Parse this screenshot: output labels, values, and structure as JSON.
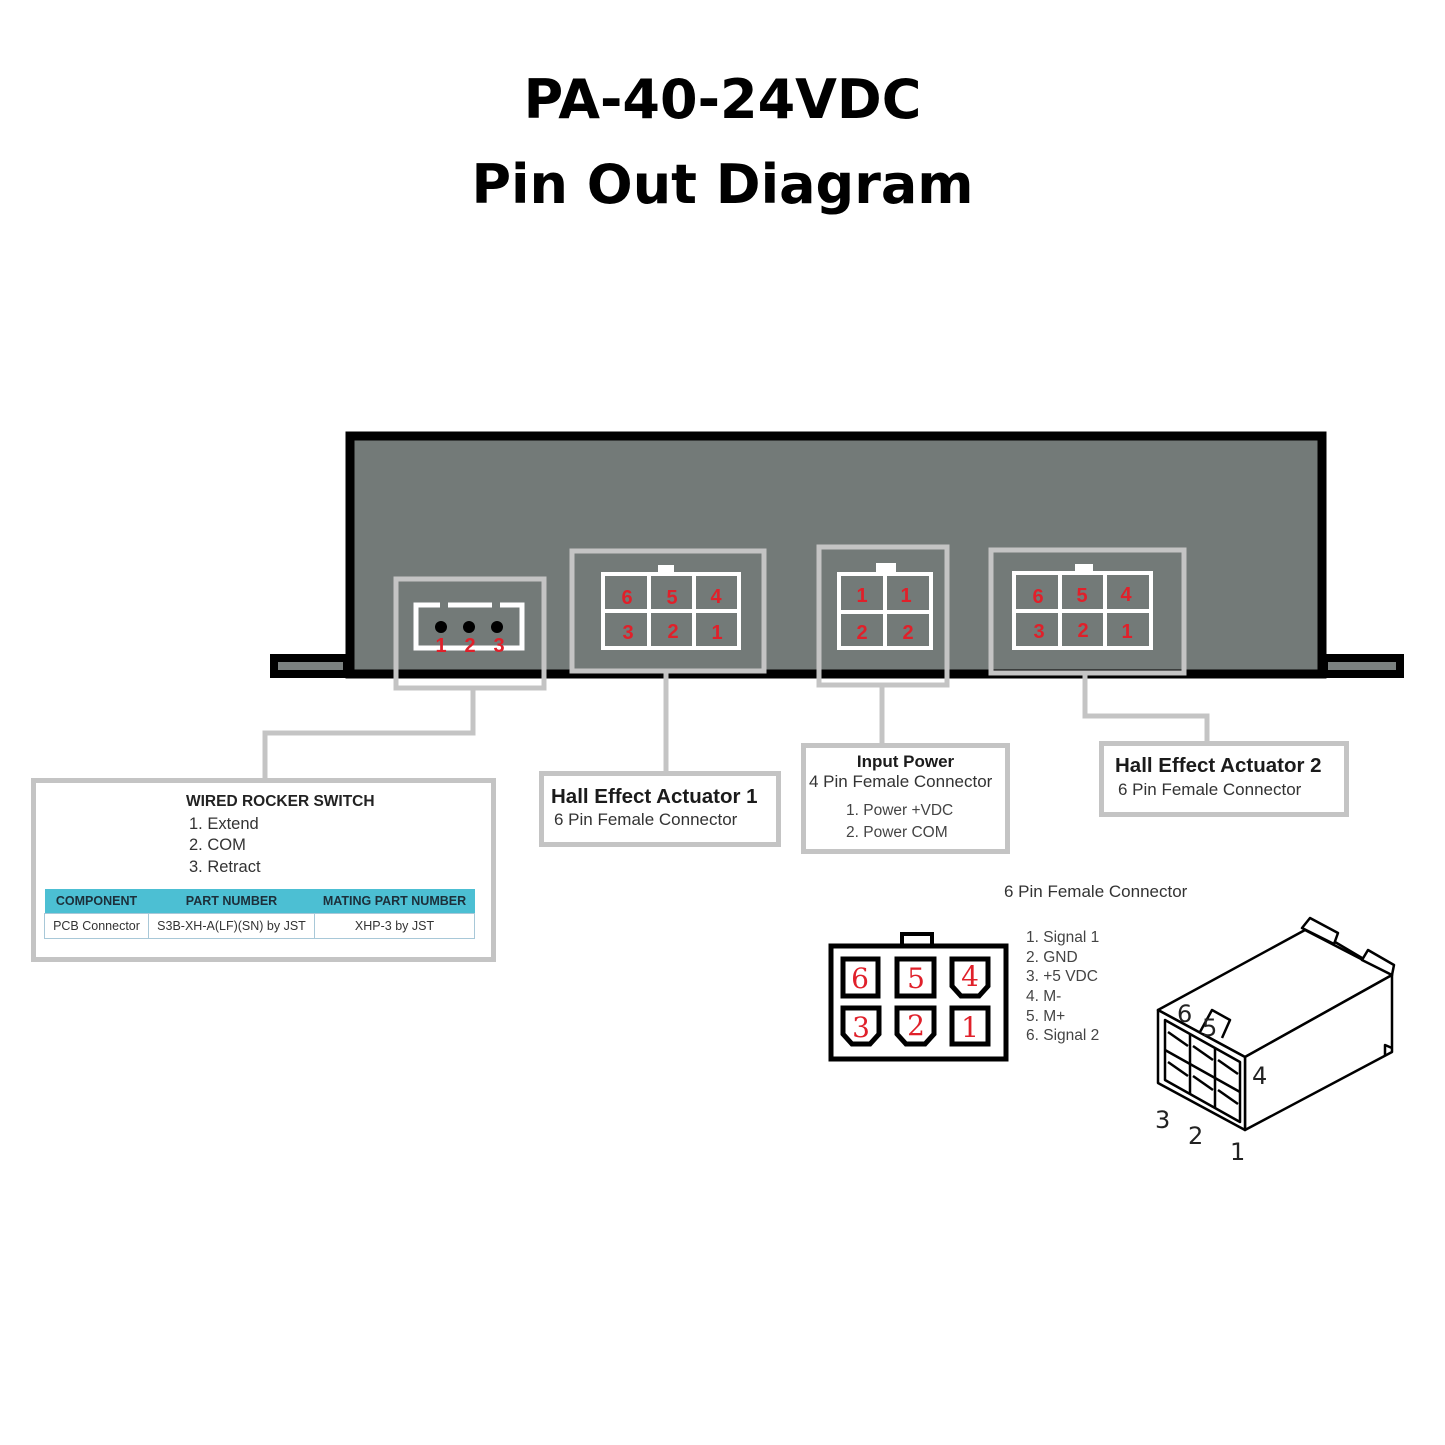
{
  "title": {
    "line1": "PA-40-24VDC",
    "line2": "Pin Out Diagram"
  },
  "colors": {
    "housing_fill": "#737a78",
    "housing_outline": "#000000",
    "callout_border": "#c4c4c4",
    "pin_number": "#e0202a",
    "table_header": "#4cbfd3"
  },
  "device_ports": {
    "rocker_pins": [
      "1",
      "2",
      "3"
    ],
    "hall1_pins_top": [
      "6",
      "5",
      "4"
    ],
    "hall1_pins_bottom": [
      "3",
      "2",
      "1"
    ],
    "power_pins_top": [
      "1",
      "1"
    ],
    "power_pins_bottom": [
      "2",
      "2"
    ],
    "hall2_pins_top": [
      "6",
      "5",
      "4"
    ],
    "hall2_pins_bottom": [
      "3",
      "2",
      "1"
    ]
  },
  "rocker_switch": {
    "title": "WIRED ROCKER SWITCH",
    "items": [
      "1. Extend",
      "2. COM",
      "3. Retract"
    ],
    "table": {
      "headers": [
        "COMPONENT",
        "PART NUMBER",
        "MATING PART NUMBER"
      ],
      "rows": [
        [
          "PCB Connector",
          "S3B-XH-A(LF)(SN) by JST",
          "XHP-3 by JST"
        ]
      ]
    }
  },
  "hall_actuator_1": {
    "title": "Hall Effect Actuator 1",
    "subtitle": "6 Pin Female Connector"
  },
  "input_power": {
    "title": "Input Power",
    "subtitle": "4 Pin Female Connector",
    "items": [
      "1. Power +VDC",
      "2. Power COM"
    ]
  },
  "hall_actuator_2": {
    "title": "Hall Effect Actuator 2",
    "subtitle": "6 Pin Female Connector"
  },
  "connector_detail": {
    "title": "6 Pin Female Connector",
    "face_pins_top": [
      "6",
      "5",
      "4"
    ],
    "face_pins_bottom": [
      "3",
      "2",
      "1"
    ],
    "pinout": [
      "1. Signal 1",
      "2. GND",
      "3. +5 VDC",
      "4. M-",
      "5. M+",
      "6. Signal 2"
    ],
    "iso_labels": [
      "6",
      "5",
      "4",
      "3",
      "2",
      "1"
    ]
  }
}
